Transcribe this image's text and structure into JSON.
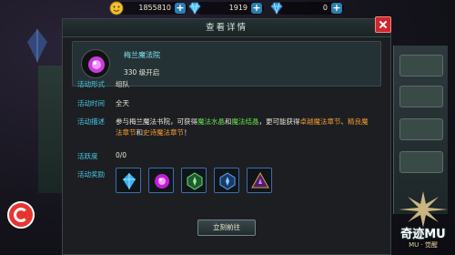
{
  "topbar": {
    "gold": {
      "icon": "gold-coin-face-icon",
      "value": "1855810"
    },
    "diamond": {
      "icon": "blue-diamond-icon",
      "value": "1919"
    },
    "bound_diamond": {
      "icon": "blue-diamond-icon",
      "value": "0"
    }
  },
  "dialog": {
    "title": "查看详情",
    "event": {
      "icon": "purple-orb-icon",
      "name": "梅兰魔法院",
      "level": "330 级开启"
    },
    "rows": {
      "form_label": "活动形式",
      "form_value": "组队",
      "time_label": "活动时间",
      "time_value": "全天",
      "desc_label": "活动描述",
      "desc_parts": {
        "p1": "参与梅兰魔法书院，可获得",
        "h1": "魔法水晶",
        "p2": "和",
        "h2": "魔法结晶",
        "p3": "，更可能获得",
        "h3": "卓越魔法章节",
        "p4": "、",
        "h4": "精良魔法章节",
        "p5": "和",
        "h5": "史诗魔法章节",
        "p6": "！"
      },
      "activity_label": "活跃度",
      "activity_value": "0/0",
      "reward_label": "活动奖励"
    },
    "rewards": [
      {
        "icon": "blue-crystal-icon"
      },
      {
        "icon": "purple-crystal-icon"
      },
      {
        "icon": "green-spellbook-chapter-icon"
      },
      {
        "icon": "blue-spellbook-chapter-icon"
      },
      {
        "icon": "purple-spellbook-chapter-icon"
      }
    ],
    "go_button": "立刻前往"
  },
  "logo": {
    "text": "奇迹MU",
    "subtitle": "MU · 觉醒"
  },
  "colors": {
    "label": "#46c8e6",
    "event_name": "#7fe4f0",
    "highlight_green": "#66e24c",
    "highlight_orange": "#f09a30",
    "close": "#d2262a"
  }
}
